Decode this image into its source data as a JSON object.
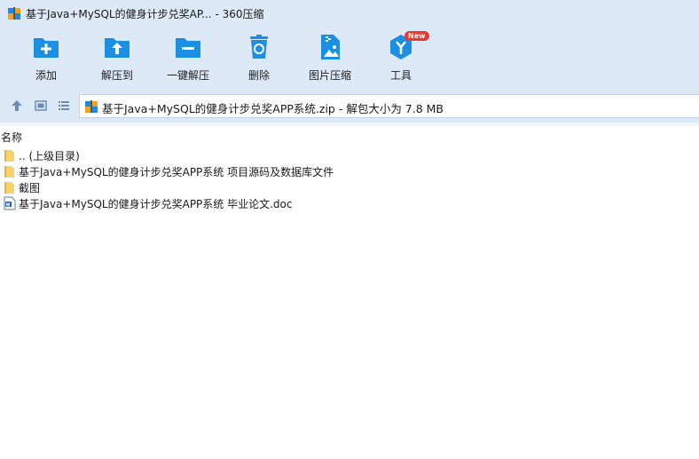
{
  "window": {
    "title": "基于Java+MySQL的健身计步兑奖AP... - 360压缩"
  },
  "toolbar": {
    "buttons": [
      {
        "label": "添加",
        "icon": "add-icon"
      },
      {
        "label": "解压到",
        "icon": "extract-to-icon"
      },
      {
        "label": "一键解压",
        "icon": "one-click-extract-icon"
      },
      {
        "label": "删除",
        "icon": "recycle-bin-icon"
      },
      {
        "label": "图片压缩",
        "icon": "image-compress-icon"
      },
      {
        "label": "工具",
        "icon": "tools-icon",
        "badge": "New"
      }
    ]
  },
  "address": {
    "text": "基于Java+MySQL的健身计步兑奖APP系统.zip - 解包大小为 7.8 MB"
  },
  "columns": {
    "name": "名称"
  },
  "files": [
    {
      "name": ".. (上级目录)",
      "icon": "folder-icon"
    },
    {
      "name": "基于Java+MySQL的健身计步兑奖APP系统 项目源码及数据库文件",
      "icon": "folder-icon"
    },
    {
      "name": "截图",
      "icon": "folder-icon"
    },
    {
      "name": "基于Java+MySQL的健身计步兑奖APP系统 毕业论文.doc",
      "icon": "word-doc-icon"
    }
  ],
  "colors": {
    "chrome": "#dde9f6",
    "icon_blue": "#1a8fe3",
    "badge_red": "#e63a2e"
  }
}
